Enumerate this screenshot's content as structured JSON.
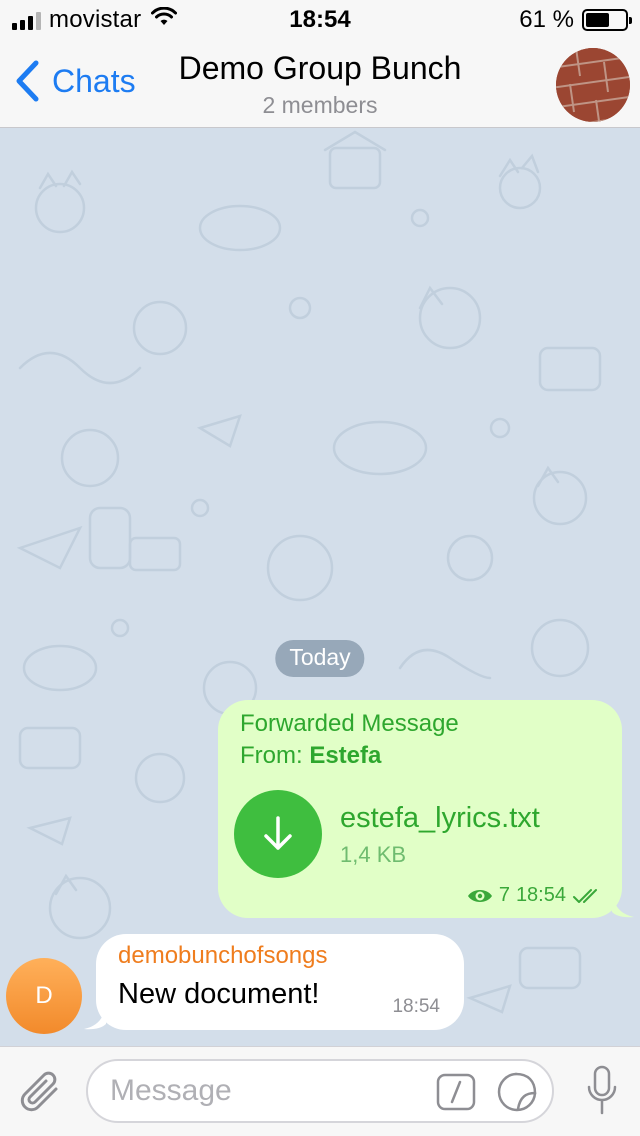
{
  "status_bar": {
    "carrier": "movistar",
    "time": "18:54",
    "battery_text": "61 %",
    "battery_level": 0.61
  },
  "nav": {
    "back_label": "Chats",
    "title": "Demo Group Bunch",
    "subtitle": "2 members"
  },
  "chat": {
    "date_separator": "Today",
    "outgoing": {
      "forwarded_label": "Forwarded Message",
      "from_prefix": "From: ",
      "from_name": "Estefa",
      "file_name": "estefa_lyrics.txt",
      "file_size": "1,4 KB",
      "views": "7",
      "time": "18:54"
    },
    "incoming": {
      "avatar_letter": "D",
      "sender": "demobunchofsongs",
      "text": "New document!",
      "time": "18:54"
    }
  },
  "input": {
    "placeholder": "Message"
  },
  "colors": {
    "accent": "#1d7cf2",
    "outgoing_bubble": "#e1ffc7",
    "outgoing_text": "#2ea72e",
    "chat_bg": "#d3deea",
    "sender_name": "#ef7d1e"
  }
}
